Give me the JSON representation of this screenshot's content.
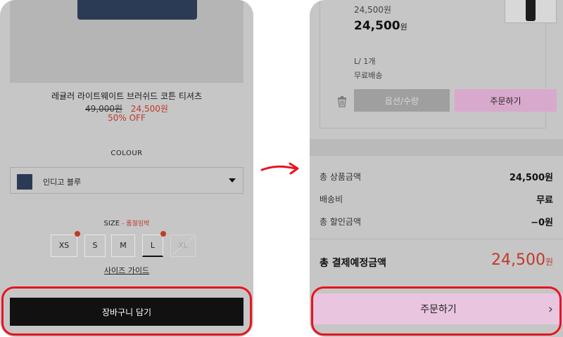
{
  "left_screen": {
    "product_name": "레귤러 라이트웨이트 브러쉬드 코튼 티셔츠",
    "price_original": "49,000원",
    "price_sale": "24,500원",
    "discount": "50% OFF",
    "colour_label": "COLOUR",
    "colour_value": "인디고 블루",
    "size_label": "SIZE",
    "size_soldout_note": "- 품절임박",
    "sizes": [
      "XS",
      "S",
      "M",
      "L",
      "XL"
    ],
    "size_selected": "L",
    "size_guide": "사이즈 가이드",
    "cart_button": "장바구니 담기"
  },
  "right_screen": {
    "item_price_original": "24,500원",
    "item_price_current": "24,500",
    "won": "원",
    "item_option": "L/ 1개",
    "item_shipping": "무료배송",
    "option_button": "옵션/수량",
    "order_button_small": "주문하기",
    "summary": {
      "subtotal_label": "총 상품금액",
      "subtotal_value": "24,500원",
      "shipping_label": "배송비",
      "shipping_value": "무료",
      "discount_label": "총 할인금액",
      "discount_value": "−0원",
      "total_label": "총 결제예정금액",
      "total_value": "24,500"
    },
    "order_button": "주문하기"
  },
  "colors": {
    "highlight": "#e8141f",
    "sale": "#c0392b",
    "order_pink": "#e9c5e0",
    "swatch_indigo": "#2c3b55"
  }
}
